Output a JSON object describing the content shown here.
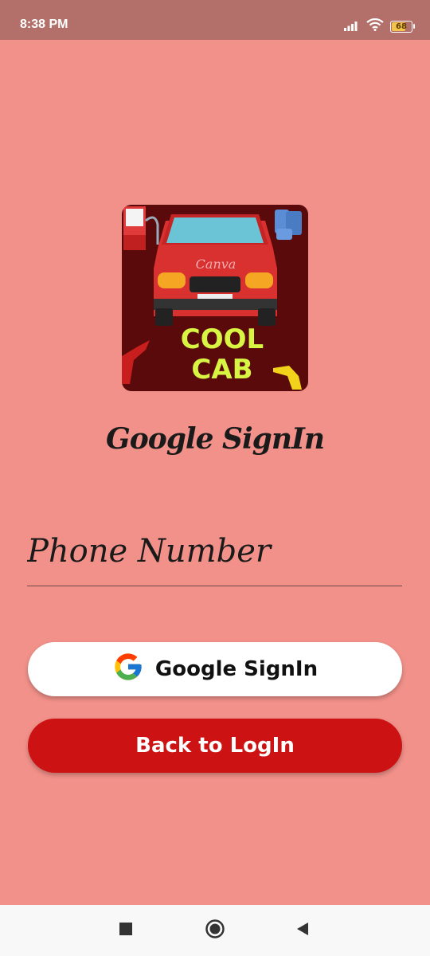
{
  "status_bar": {
    "time": "8:38 PM",
    "battery": "68"
  },
  "logo": {
    "line1": "COOL",
    "line2": "CAB",
    "watermark": "Canva"
  },
  "page": {
    "title": "Google SignIn"
  },
  "phone_field": {
    "placeholder": "Phone Number",
    "value": ""
  },
  "buttons": {
    "google_signin": "Google SignIn",
    "back_to_login": "Back to LogIn"
  },
  "colors": {
    "background": "#f2918a",
    "status_bar": "#b3706b",
    "back_button": "#cc1212",
    "google_button": "#ffffff"
  },
  "icons": {
    "status": [
      "signal-icon",
      "wifi-icon",
      "battery-icon"
    ],
    "nav": [
      "recents-icon",
      "home-icon",
      "back-icon"
    ]
  }
}
